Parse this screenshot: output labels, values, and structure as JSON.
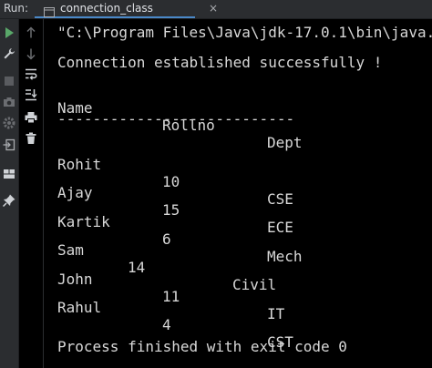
{
  "tabbar": {
    "run_label": "Run:",
    "tab_label": "connection_class",
    "close_glyph": "×"
  },
  "colors": {
    "run_green": "#59a869",
    "tab_accent": "#4a88c7",
    "icon_gray": "#a9abaf",
    "console_text": "#d8d8d8"
  },
  "console": {
    "command": "\"C:\\Program Files\\Java\\jdk-17.0.1\\bin\\java.",
    "status": "Connection established successfully !",
    "headers": [
      "Name",
      "Rollno",
      "Dept"
    ],
    "separator": "---------------------------",
    "rows": [
      [
        "Rohit",
        "10",
        "CSE"
      ],
      [
        "Ajay",
        "15",
        "ECE"
      ],
      [
        "Kartik",
        "6",
        "Mech"
      ],
      [
        "Sam",
        "14",
        "Civil"
      ],
      [
        "John",
        "11",
        "IT"
      ],
      [
        "Rahul",
        "4",
        "CST"
      ]
    ],
    "exit": "Process finished with exit code 0"
  },
  "toolbar_icons": [
    "rerun-icon",
    "wrench-icon",
    "stop-icon",
    "camera-icon",
    "settings-icon",
    "exit-icon",
    "layout-icon",
    "pin-icon",
    "arrow-up-icon",
    "arrow-down-icon",
    "soft-wrap-icon",
    "scroll-to-end-icon",
    "print-icon",
    "trash-icon"
  ]
}
